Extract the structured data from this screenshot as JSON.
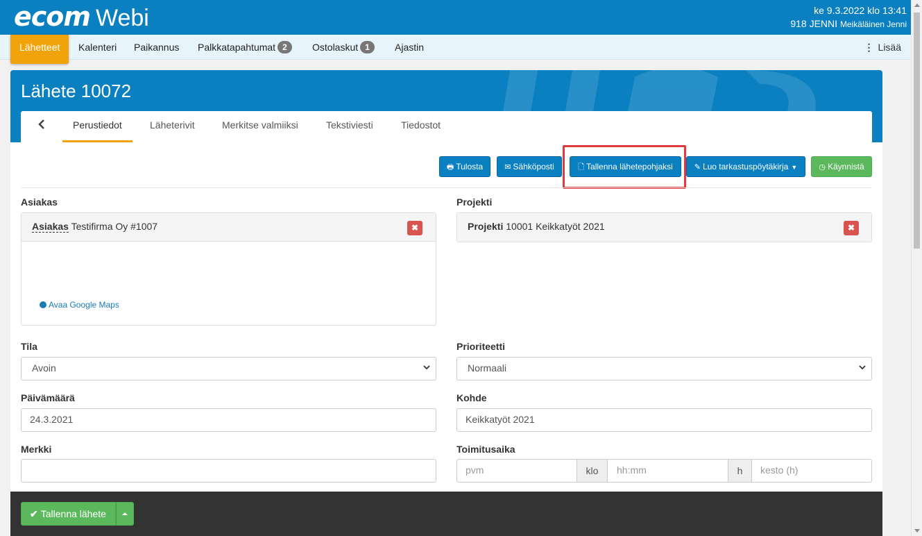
{
  "app": {
    "brand": "ecom",
    "product": "Webi"
  },
  "user": {
    "datetime": "ke 9.3.2022 klo 13:41",
    "id": "918 JENNI",
    "name": "Meikäläinen Jenni"
  },
  "nav": {
    "items": [
      {
        "label": "Lähetteet",
        "active": true
      },
      {
        "label": "Kalenteri"
      },
      {
        "label": "Paikannus"
      },
      {
        "label": "Palkkatapahtumat",
        "badge": "2"
      },
      {
        "label": "Ostolaskut",
        "badge": "1"
      },
      {
        "label": "Ajastin"
      }
    ],
    "more": "Lisää"
  },
  "page": {
    "title": "Lähete 10072"
  },
  "tabs": [
    "Perustiedot",
    "Läheterivit",
    "Merkitse valmiiksi",
    "Tekstiviesti",
    "Tiedostot"
  ],
  "actions": {
    "print": "Tulosta",
    "email": "Sähköposti",
    "save_template": "Tallenna lähetepohjaksi",
    "create_report": "Luo tarkastuspöytäkirja",
    "start": "Käynnistä"
  },
  "customer": {
    "section_label": "Asiakas",
    "key": "Asiakas",
    "value": "Testifirma Oy #1007",
    "map_link": "Avaa Google Maps",
    "remove": "✖"
  },
  "project": {
    "section_label": "Projekti",
    "key": "Projekti",
    "value": "10001 Keikkatyöt 2021",
    "remove": "✖"
  },
  "form": {
    "status": {
      "label": "Tila",
      "value": "Avoin"
    },
    "priority": {
      "label": "Prioriteetti",
      "value": "Normaali"
    },
    "date": {
      "label": "Päivämäärä",
      "value": "24.3.2021"
    },
    "target": {
      "label": "Kohde",
      "value": "Keikkatyöt 2021"
    },
    "mark": {
      "label": "Merkki",
      "value": ""
    },
    "delivery": {
      "label": "Toimitusaika",
      "date_placeholder": "pvm",
      "klo": "klo",
      "time_placeholder": "hh:mm",
      "h": "h",
      "duration_placeholder": "kesto (h)"
    }
  },
  "footer": {
    "save_label": "Tallenna lähete"
  },
  "colors": {
    "primary": "#0a80c1",
    "accent": "#f0a30a",
    "success": "#5cb85c",
    "danger": "#d9534f",
    "highlight": "#e0393e"
  }
}
